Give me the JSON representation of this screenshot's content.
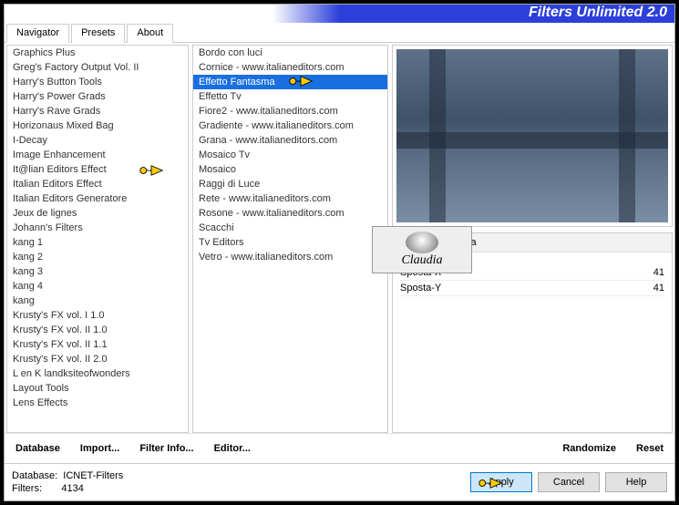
{
  "header": {
    "title": "Filters Unlimited 2.0"
  },
  "tabs": {
    "items": [
      "Navigator",
      "Presets",
      "About"
    ],
    "activeIndex": 0
  },
  "leftList": {
    "items": [
      "Graphics Plus",
      "Greg's Factory Output Vol. II",
      "Harry's Button Tools",
      "Harry's Power Grads",
      "Harry's Rave Grads",
      "Horizonaus Mixed Bag",
      "I-Decay",
      "Image Enhancement",
      "It@lian Editors Effect",
      "Italian Editors Effect",
      "Italian Editors Generatore",
      "Jeux de lignes",
      "Johann's Filters",
      "kang 1",
      "kang 2",
      "kang 3",
      "kang 4",
      "kang",
      "Krusty's FX vol. I 1.0",
      "Krusty's FX vol. II 1.0",
      "Krusty's FX vol. II 1.1",
      "Krusty's FX vol. II 2.0",
      "L en K landksiteofwonders",
      "Layout Tools",
      "Lens Effects"
    ],
    "selectedIndex": -1
  },
  "midList": {
    "items": [
      "Bordo con luci",
      "Cornice - www.italianeditors.com",
      "Effetto Fantasma",
      "Effetto Tv",
      "Fiore2 - www.italianeditors.com",
      "Gradiente - www.italianeditors.com",
      "Grana - www.italianeditors.com",
      "Mosaico Tv",
      "Mosaico",
      "Raggi di Luce",
      "Rete - www.italianeditors.com",
      "Rosone - www.italianeditors.com",
      "Scacchi",
      "Tv Editors",
      "Vetro - www.italianeditors.com"
    ],
    "selectedIndex": 2
  },
  "params": {
    "title": "Effetto Fantasma",
    "rows": [
      {
        "label": "Sposta-X",
        "value": "41"
      },
      {
        "label": "Sposta-Y",
        "value": "41"
      }
    ]
  },
  "controls": {
    "database": "Database",
    "import": "Import...",
    "filterInfo": "Filter Info...",
    "editor": "Editor...",
    "randomize": "Randomize",
    "reset": "Reset"
  },
  "footer": {
    "databaseLabel": "Database:",
    "databaseValue": "ICNET-Filters",
    "filtersLabel": "Filters:",
    "filtersValue": "4134",
    "apply": "Apply",
    "cancel": "Cancel",
    "help": "Help"
  },
  "logo": {
    "text": "Claudia"
  }
}
